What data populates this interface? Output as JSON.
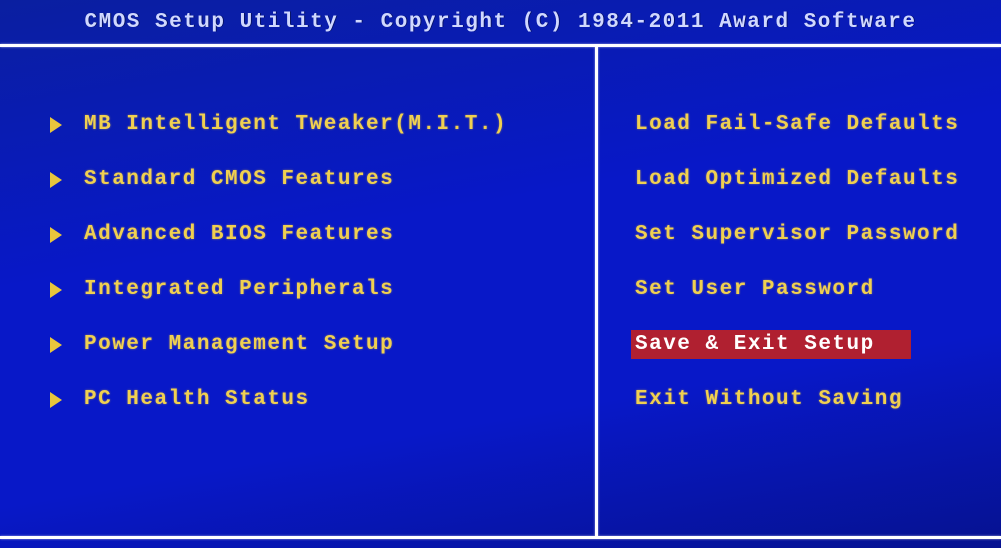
{
  "title": "CMOS Setup Utility - Copyright (C) 1984-2011 Award Software",
  "left_menu": [
    {
      "label": "MB Intelligent Tweaker(M.I.T.)",
      "submenu": true
    },
    {
      "label": "Standard CMOS Features",
      "submenu": true
    },
    {
      "label": "Advanced BIOS Features",
      "submenu": true
    },
    {
      "label": "Integrated Peripherals",
      "submenu": true
    },
    {
      "label": "Power Management Setup",
      "submenu": true
    },
    {
      "label": "PC Health Status",
      "submenu": true
    }
  ],
  "right_menu": [
    {
      "label": "Load Fail-Safe Defaults",
      "selected": false
    },
    {
      "label": "Load Optimized Defaults",
      "selected": false
    },
    {
      "label": "Set Supervisor Password",
      "selected": false
    },
    {
      "label": "Set User Password",
      "selected": false
    },
    {
      "label": "Save & Exit Setup",
      "selected": true
    },
    {
      "label": "Exit Without Saving",
      "selected": false
    }
  ],
  "colors": {
    "background": "#0818c8",
    "menu_text": "#f0d050",
    "highlight": "#b02030",
    "rule": "#ffffff"
  }
}
